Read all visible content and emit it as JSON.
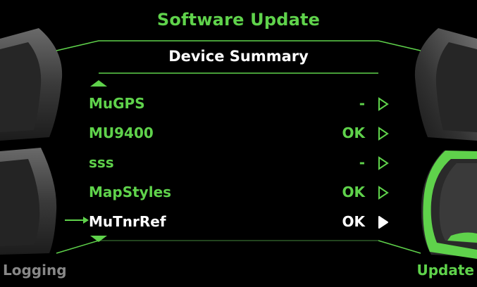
{
  "header": {
    "title": "Software Update",
    "subtitle": "Device Summary"
  },
  "devices": [
    {
      "name": "MuGPS",
      "status": "-"
    },
    {
      "name": "MU9400",
      "status": "OK"
    },
    {
      "name": "sss",
      "status": "-"
    },
    {
      "name": "MapStyles",
      "status": "OK"
    },
    {
      "name": "MuTnrRef",
      "status": "OK",
      "selected": true
    }
  ],
  "softkeys": {
    "left": "Logging",
    "right": "Update"
  },
  "colors": {
    "accent": "#5fd24b",
    "selected": "#ffffff",
    "inactive": "#888888",
    "background": "#000000"
  }
}
